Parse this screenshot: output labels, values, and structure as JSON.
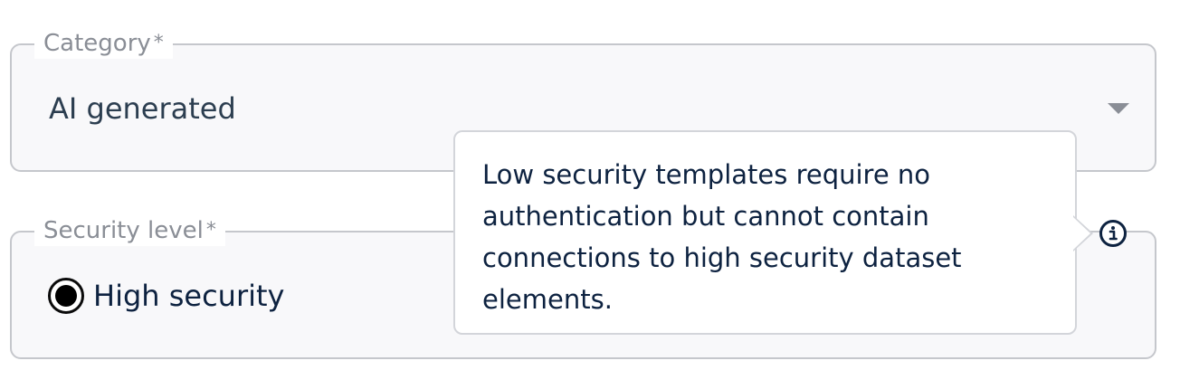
{
  "category": {
    "label": "Category",
    "required_mark": "*",
    "value": "AI generated",
    "dropdown_icon": "chevron-down-icon"
  },
  "security": {
    "label": "Security level",
    "required_mark": "*",
    "options": [
      {
        "label": "High security",
        "selected": true
      }
    ],
    "info_icon": "info-icon"
  },
  "tooltip": {
    "text": "Low security templates require no authentication but cannot contain connections to high security dataset elements."
  },
  "colors": {
    "text_primary": "#0d2240",
    "field_border": "#c5c7cc",
    "field_background": "#f8f8fa",
    "label_muted": "#8a8e96"
  }
}
